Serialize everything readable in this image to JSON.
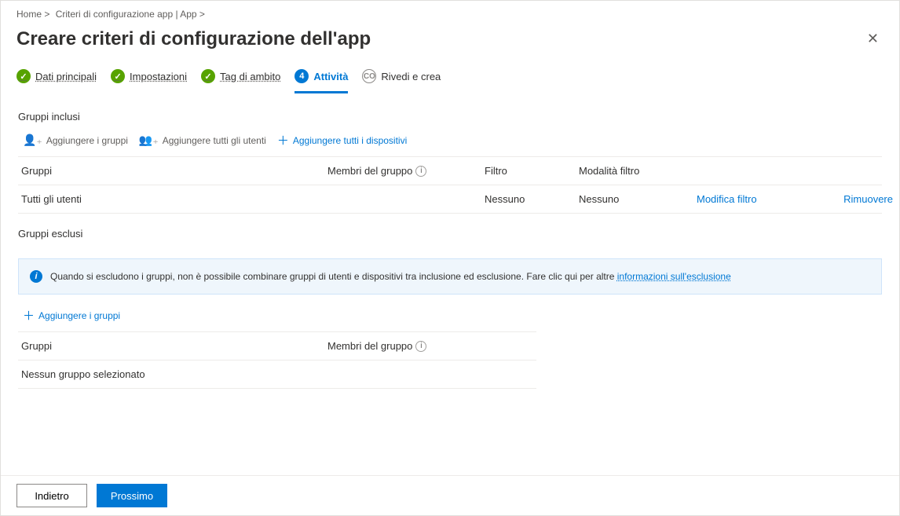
{
  "breadcrumb": {
    "home": "Home >",
    "policies": "Criteri di configurazione app | App >"
  },
  "page_title": "Creare criteri di configurazione dell'app",
  "wizard": {
    "steps": [
      {
        "label": "Dati principali",
        "state": "done"
      },
      {
        "label": "Impostazioni",
        "state": "done"
      },
      {
        "label": "Tag di ambito",
        "state": "done"
      },
      {
        "label": "Attività",
        "state": "active",
        "number": "4"
      },
      {
        "label": "Rivedi e crea",
        "state": "pending",
        "badge": "CO"
      }
    ]
  },
  "included": {
    "heading": "Gruppi inclusi",
    "actions": {
      "add_groups": "Aggiungere i gruppi",
      "add_users": "Aggiungere tutti gli utenti",
      "add_devices": "Aggiungere tutti i dispositivi"
    },
    "columns": {
      "groups": "Gruppi",
      "members": "Membri del gruppo",
      "filter": "Filtro",
      "mode": "Modalità filtro"
    },
    "rows": [
      {
        "groups": "Tutti gli utenti",
        "members": "",
        "filter": "Nessuno",
        "mode": "Nessuno",
        "edit": "Modifica filtro",
        "remove": "Rimuovere"
      }
    ]
  },
  "excluded": {
    "heading": "Gruppi esclusi",
    "info_text": "Quando si escludono i gruppi, non è possibile combinare gruppi di utenti e dispositivi tra inclusione ed esclusione. Fare clic qui per altre ",
    "info_link": "informazioni sull'esclusione",
    "actions": {
      "add_groups": "Aggiungere i gruppi"
    },
    "columns": {
      "groups": "Gruppi",
      "members": "Membri del gruppo"
    },
    "empty": "Nessun gruppo selezionato"
  },
  "footer": {
    "back": "Indietro",
    "next": "Prossimo"
  }
}
